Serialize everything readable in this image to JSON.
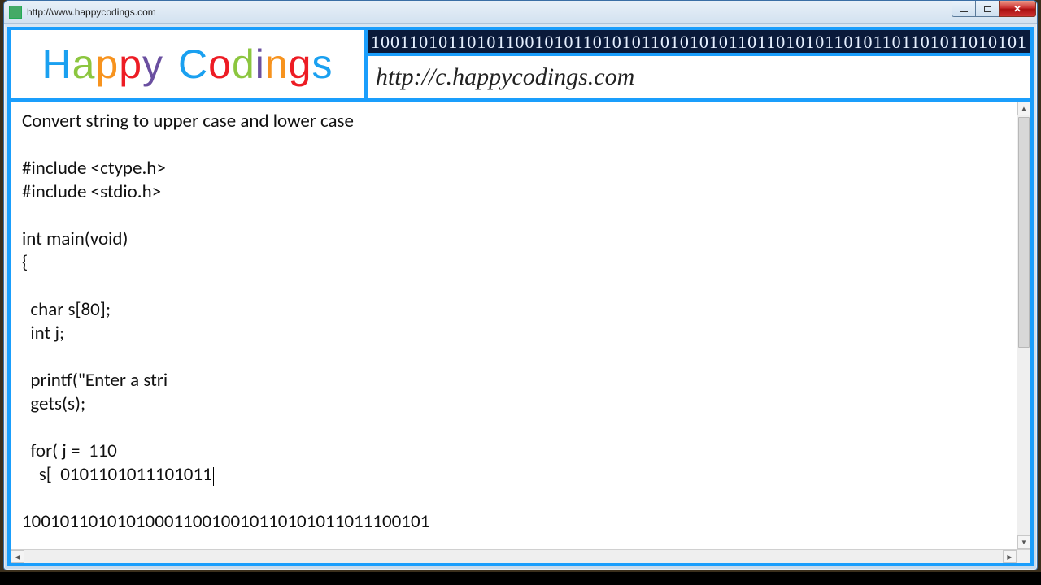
{
  "window": {
    "title": "http://www.happycodings.com"
  },
  "header": {
    "logo_word1": {
      "l0": "H",
      "l1": "a",
      "l2": "p",
      "l3": "p",
      "l4": "y"
    },
    "logo_word2": {
      "l0": "C",
      "l1": "o",
      "l2": "d",
      "l3": "i",
      "l4": "n",
      "l5": "g",
      "l6": "s"
    },
    "binary_strip": "10011010110101100101011010101101010101101101010110101101101011010101",
    "site_url": "http://c.happycodings.com"
  },
  "code": {
    "title": "Convert string to upper case and lower case",
    "blank0": "",
    "inc1": "#include <ctype.h>",
    "inc2": "#include <stdio.h>",
    "blank1": "",
    "main": "int main(void)",
    "brace": "{",
    "blank2": "",
    "decl1": "  char s[80];",
    "decl2": "  int j;",
    "blank3": "",
    "printf": "  printf(\"Enter a stri",
    "gets": "  gets(s);",
    "blank4": "",
    "for": "  for( j =  110",
    "arr_pre": "    s[  0101101011101011",
    "blank5": "",
    "binrow": "1001011010101000110010010110101011011100101"
  }
}
